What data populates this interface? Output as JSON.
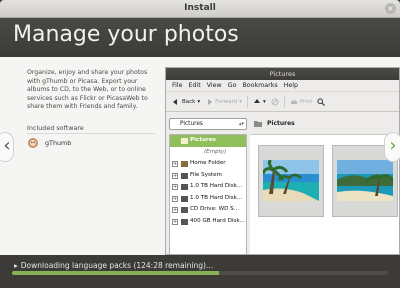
{
  "window": {
    "title": "Install",
    "close_glyph": "×"
  },
  "header": {
    "title": "Manage your photos"
  },
  "slide": {
    "description": "Organize, enjoy and share your photos with gThumb or Picasa. Export your albums to CD, to the Web, or to online services such as Flickr or PicasaWeb to share them with Friends and family.",
    "included_heading": "Included software",
    "software": [
      {
        "name": "gThumb",
        "icon": "gthumb-icon"
      }
    ],
    "nav_prev": "‹",
    "nav_next": "›"
  },
  "gthumb": {
    "title": "Pictures",
    "menu": [
      "File",
      "Edit",
      "View",
      "Go",
      "Bookmarks",
      "Help"
    ],
    "toolbar": {
      "back": "Back",
      "forward": "Forward",
      "print": "Print"
    },
    "location": "Pictures",
    "breadcrumb": "Pictures",
    "tree": [
      {
        "label": "Pictures",
        "selected": true,
        "expander": "",
        "icon": "folder-icon"
      },
      {
        "label": "(Empty)",
        "empty": true
      },
      {
        "label": "Home Folder",
        "expander": "+",
        "icon": "home-icon"
      },
      {
        "label": "File System",
        "expander": "+",
        "icon": "drive-icon"
      },
      {
        "label": "1.0 TB Hard Disk...",
        "expander": "+",
        "icon": "drive-icon"
      },
      {
        "label": "1.0 TB Hard Disk...",
        "expander": "+",
        "icon": "drive-icon"
      },
      {
        "label": "CD Drive: WD S...",
        "expander": "+",
        "icon": "cd-icon"
      },
      {
        "label": "400 GB Hard Disk...",
        "expander": "+",
        "icon": "drive-icon"
      }
    ]
  },
  "status": {
    "text": "Downloading language packs (124:28 remaining)...",
    "progress_fraction": 0.55,
    "accent": "#87b158"
  }
}
